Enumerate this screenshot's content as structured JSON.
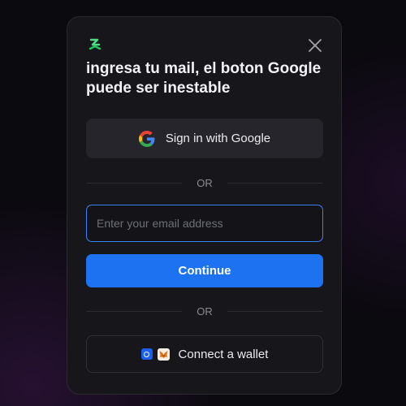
{
  "modal": {
    "title": "ingresa tu mail, el boton Google puede ser inestable",
    "google_button_label": "Sign in with Google",
    "divider_label_1": "OR",
    "email": {
      "placeholder": "Enter your email address",
      "value": ""
    },
    "continue_label": "Continue",
    "divider_label_2": "OR",
    "wallet_button_label": "Connect a wallet",
    "icons": {
      "logo": "app-logo-icon",
      "close": "close-icon",
      "google": "google-icon",
      "coinbase": "coinbase-wallet-icon",
      "metamask": "metamask-icon"
    }
  },
  "colors": {
    "accent": "#1d72f2",
    "input_focus_border": "#3b82f6",
    "modal_background": "#17171b",
    "logo_green": "#34c759"
  }
}
